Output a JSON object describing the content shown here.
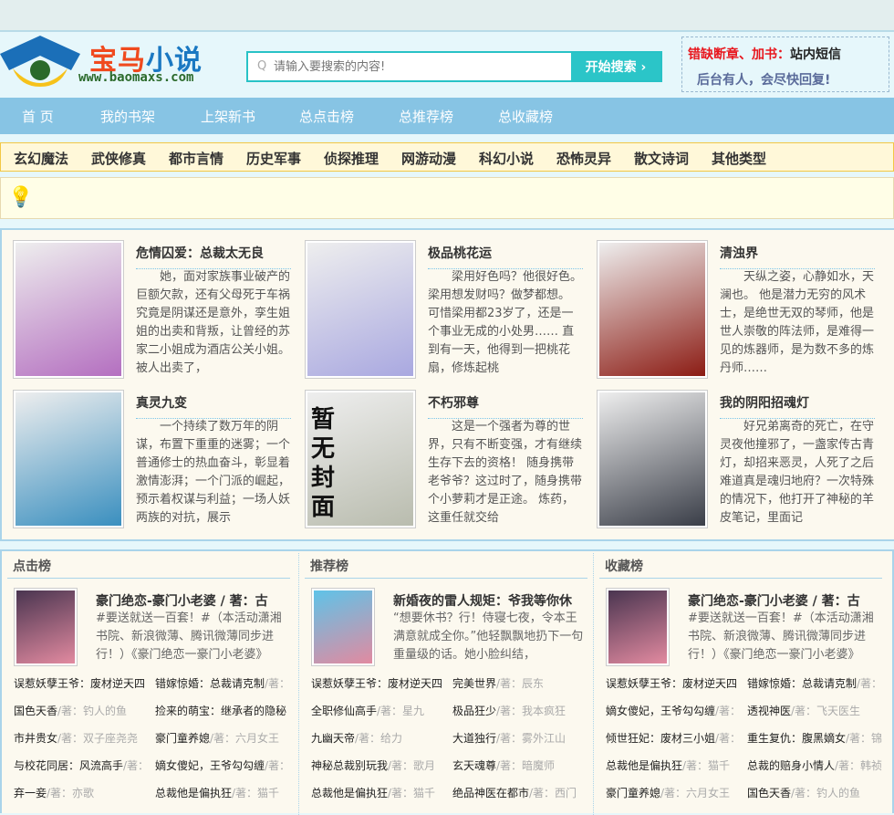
{
  "site": {
    "name_a": "宝马",
    "name_b": "小说",
    "url": "www.baomaxs.com"
  },
  "search": {
    "placeholder": "请输入要搜索的内容!",
    "button": "开始搜索 ›"
  },
  "notice": {
    "red": "错缺断章、加书：",
    "black": "站内短信",
    "line2": "后台有人，会尽快回复!"
  },
  "nav": [
    "首  页",
    "我的书架",
    "上架新书",
    "总点击榜",
    "总推荐榜",
    "总收藏榜"
  ],
  "categories": [
    "玄幻魔法",
    "武侠修真",
    "都市言情",
    "历史军事",
    "侦探推理",
    "网游动漫",
    "科幻小说",
    "恐怖灵异",
    "散文诗词",
    "其他类型"
  ],
  "tips_icon": "lightbulb-icon",
  "featured": [
    {
      "title": "危情囚爱：总裁太无良",
      "desc": "她，面对家族事业破产的巨额欠款，还有父母死于车祸究竟是阴谋还是意外，孪生姐姐的出卖和背叛，让曾经的苏家二小姐成为酒店公关小姐。 被人出卖了，",
      "color": "#b46fc0"
    },
    {
      "title": "极品桃花运",
      "desc": "梁用好色吗？他很好色。 梁用想发财吗？做梦都想。 可惜梁用都23岁了，还是一个事业无成的小处男…… 直到有一天，他得到一把桃花扇，修炼起桃",
      "color": "#a9a8e0"
    },
    {
      "title": "清浊界",
      "desc": "天纵之姿，心静如水，天澜也。 他是潜力无穷的风术士，是绝世无双的琴师，他是世人崇敬的阵法师，是难得一见的炼器师，是为数不多的炼丹师……",
      "color": "#8c1c14"
    },
    {
      "title": "真灵九变",
      "desc": "一个持续了数万年的阴谋，布置下重重的迷雾；一个普通修士的热血奋斗，彰显着激情澎湃；一个门派的崛起，预示着权谋与利益；一场人妖两族的对抗，展示",
      "color": "#3a8fbf"
    },
    {
      "title": "不朽邪尊",
      "desc": "这是一个强者为尊的世界，只有不断变强，才有继续生存下去的资格！ 随身携带老爷爷？这过时了，随身携带个小萝莉才是正途。 炼药，这重任就交给",
      "color": "#b9bcae",
      "cover_text": "暂无封面"
    },
    {
      "title": "我的阴阳招魂灯",
      "desc": "好兄弟离奇的死亡，在守灵夜他撞邪了，一盏家传古青灯，却招来恶灵，人死了之后难道真是魂归地府？一次特殊的情况下，他打开了神秘的羊皮笔记，里面记",
      "color": "#3a3e48"
    }
  ],
  "rankings": [
    {
      "title": "点击榜",
      "top": {
        "title": "豪门绝恋-豪门小老婆 / 著：古",
        "desc": "#要送就送一百套！#（本活动潇湘书院、新浪微薄、腾讯微薄同步进行！）《豪门绝恋一豪门小老婆》",
        "color": "#4a3550"
      },
      "items": [
        {
          "t": "误惹妖孽王爷：废材逆天四",
          "a": ""
        },
        {
          "t": "错嫁惊婚：总裁请克制",
          "a": "/著："
        },
        {
          "t": "国色天香",
          "a": "/著：钓人的鱼"
        },
        {
          "t": "捡来的萌宝：继承者的隐秘",
          "a": ""
        },
        {
          "t": "市井贵女",
          "a": "/著：双子座尧尧"
        },
        {
          "t": "豪门童养媳",
          "a": "/著：六月女王"
        },
        {
          "t": "与校花同居：风流高手",
          "a": "/著："
        },
        {
          "t": "嫡女傻妃，王爷勾勾缠",
          "a": "/著："
        },
        {
          "t": "弃一妾",
          "a": "/著：亦歌"
        },
        {
          "t": "总裁他是偏执狂",
          "a": "/著：猫千"
        }
      ]
    },
    {
      "title": "推荐榜",
      "top": {
        "title": "新婚夜的雷人规矩：爷我等你休",
        "desc": "“想要休书？行！侍寝七夜，令本王满意就成全你。”他轻飘飘地扔下一句重量级的话。她小脸纠结，",
        "color": "#5fc3e8"
      },
      "items": [
        {
          "t": "误惹妖孽王爷：废材逆天四",
          "a": ""
        },
        {
          "t": "完美世界",
          "a": "/著：辰东"
        },
        {
          "t": "全职修仙高手",
          "a": "/著：星九"
        },
        {
          "t": "极品狂少",
          "a": "/著：我本疯狂"
        },
        {
          "t": "九幽天帝",
          "a": "/著：给力"
        },
        {
          "t": "大道独行",
          "a": "/著：雾外江山"
        },
        {
          "t": "神秘总裁别玩我",
          "a": "/著：歌月"
        },
        {
          "t": "玄天魂尊",
          "a": "/著：暗魔师"
        },
        {
          "t": "总裁他是偏执狂",
          "a": "/著：猫千"
        },
        {
          "t": "绝品神医在都市",
          "a": "/著：西门"
        }
      ]
    },
    {
      "title": "收藏榜",
      "top": {
        "title": "豪门绝恋-豪门小老婆 / 著：古",
        "desc": "#要送就送一百套！#（本活动潇湘书院、新浪微薄、腾讯微薄同步进行！）《豪门绝恋一豪门小老婆》",
        "color": "#4a3550"
      },
      "items": [
        {
          "t": "误惹妖孽王爷：废材逆天四",
          "a": ""
        },
        {
          "t": "错嫁惊婚：总裁请克制",
          "a": "/著："
        },
        {
          "t": "嫡女傻妃，王爷勾勾缠",
          "a": "/著："
        },
        {
          "t": "透视神医",
          "a": "/著：飞天医生"
        },
        {
          "t": "倾世狂妃：废材三小姐",
          "a": "/著："
        },
        {
          "t": "重生复仇：腹黑嫡女",
          "a": "/著：锦"
        },
        {
          "t": "总裁他是偏执狂",
          "a": "/著：猫千"
        },
        {
          "t": "总裁的赔身小情人",
          "a": "/著：韩祯"
        },
        {
          "t": "豪门童养媳",
          "a": "/著：六月女王"
        },
        {
          "t": "国色天香",
          "a": "/著：钓人的鱼"
        }
      ]
    }
  ]
}
